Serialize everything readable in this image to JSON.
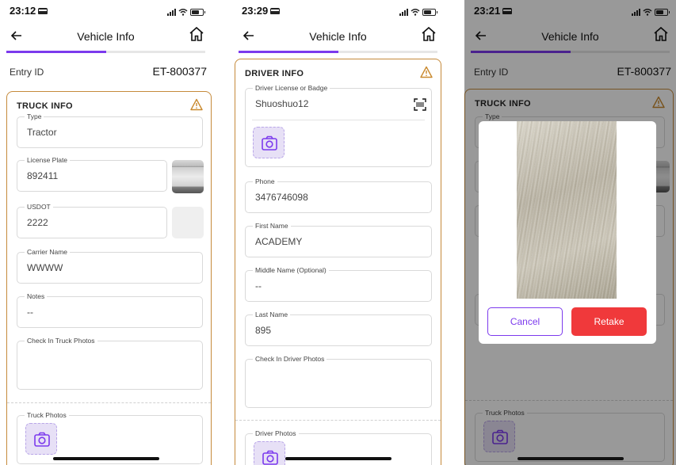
{
  "screens": [
    {
      "time": "23:12",
      "nav_title": "Vehicle Info",
      "progress": 0.5,
      "entry": {
        "label": "Entry ID",
        "value": "ET-800377"
      },
      "card_title": "TRUCK INFO",
      "fields": {
        "type": {
          "label": "Type",
          "value": "Tractor"
        },
        "license_plate": {
          "label": "License Plate",
          "value": "892411"
        },
        "usdot": {
          "label": "USDOT",
          "value": "2222"
        },
        "carrier_name": {
          "label": "Carrier Name",
          "value": "WWWW"
        },
        "notes": {
          "label": "Notes",
          "value": "--"
        },
        "check_in_photos": {
          "label": "Check In Truck Photos"
        },
        "truck_photos": {
          "label": "Truck Photos"
        }
      }
    },
    {
      "time": "23:29",
      "nav_title": "Vehicle Info",
      "progress": 0.5,
      "card_title": "DRIVER INFO",
      "fields": {
        "license": {
          "label": "Driver License or Badge",
          "value": "Shuoshuo12"
        },
        "phone": {
          "label": "Phone",
          "value": "3476746098"
        },
        "first_name": {
          "label": "First Name",
          "value": "ACADEMY"
        },
        "middle_name": {
          "label": "Middle Name (Optional)",
          "value": "--"
        },
        "last_name": {
          "label": "Last Name",
          "value": "895"
        },
        "check_in_photos": {
          "label": "Check In Driver Photos"
        },
        "driver_photos": {
          "label": "Driver Photos"
        }
      }
    },
    {
      "time": "23:21",
      "nav_title": "Vehicle Info",
      "progress": 0.5,
      "entry": {
        "label": "Entry ID",
        "value": "ET-800377"
      },
      "card_title": "TRUCK INFO",
      "fields": {
        "type": {
          "label": "Type"
        },
        "truck_photos": {
          "label": "Truck Photos"
        }
      },
      "modal": {
        "cancel_label": "Cancel",
        "retake_label": "Retake"
      }
    }
  ],
  "colors": {
    "accent": "#7c3aed",
    "card_border": "#c58a3b",
    "warning": "#c9892e",
    "retake": "#f0393b"
  },
  "icons": [
    "back-arrow-icon",
    "home-icon",
    "warning-icon",
    "camera-icon",
    "scan-icon",
    "signal-icon",
    "wifi-icon",
    "battery-icon"
  ]
}
